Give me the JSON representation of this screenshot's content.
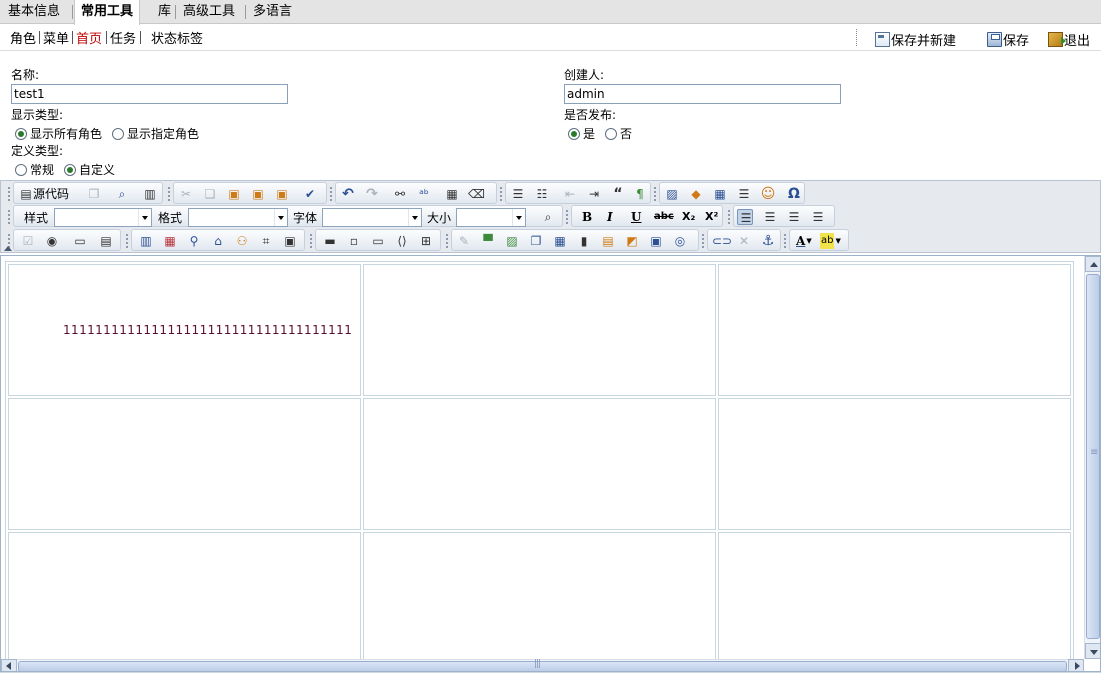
{
  "tabs": [
    {
      "label": "基本信息",
      "active": false
    },
    {
      "label": "常用工具",
      "active": true
    },
    {
      "label": "库",
      "active": false
    },
    {
      "label": "高级工具",
      "active": false
    },
    {
      "label": "多语言",
      "active": false
    }
  ],
  "subnav": [
    {
      "label": "角色",
      "current": false
    },
    {
      "label": "菜单",
      "current": false
    },
    {
      "label": "首页",
      "current": true
    },
    {
      "label": "任务",
      "current": false
    },
    {
      "label": "状态标签",
      "current": false
    }
  ],
  "actions": {
    "save_new": "保存并新建",
    "save": "保存",
    "exit": "退出"
  },
  "form": {
    "name_label": "名称:",
    "name_value": "test1",
    "creator_label": "创建人:",
    "creator_value": "admin",
    "display_type_label": "显示类型:",
    "display_type_options": [
      "显示所有角色",
      "显示指定角色"
    ],
    "display_type_selected": "显示所有角色",
    "publish_label": "是否发布:",
    "publish_options": [
      "是",
      "否"
    ],
    "publish_selected": "是",
    "define_type_label": "定义类型:",
    "define_type_options": [
      "常规",
      "自定义"
    ],
    "define_type_selected": "自定义"
  },
  "toolbar": {
    "source_label": "源代码",
    "style_label": "样式",
    "format_label": "格式",
    "font_label": "字体",
    "size_label": "大小",
    "bold_glyph": "B",
    "italic_glyph": "I",
    "underline_glyph": "U",
    "strike_glyph": "abc",
    "subscript_glyph": "X₂",
    "superscript_glyph": "X²",
    "omega_glyph": "Ω",
    "font_color_glyph": "A",
    "highlight_glyph": "ab"
  },
  "editor": {
    "table": [
      [
        "111111111111111111111111111111111111",
        "",
        ""
      ],
      [
        "",
        "",
        ""
      ],
      [
        "",
        "",
        ""
      ]
    ]
  },
  "colors": {
    "accent": "#c00000",
    "toolbar_bg": "#e6e9ee",
    "cell_text": "#5a0f2e",
    "radio_dot": "#2a7a2a"
  }
}
